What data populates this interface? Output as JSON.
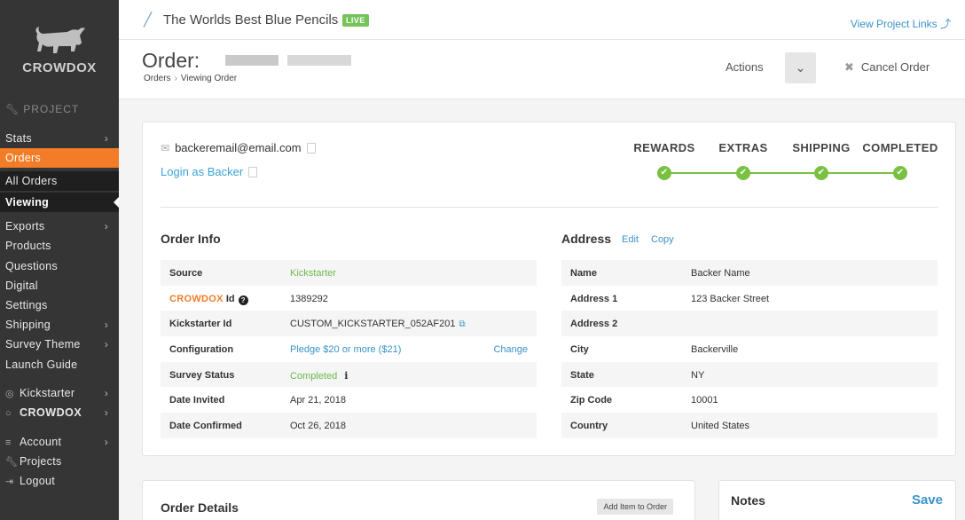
{
  "sidebar": {
    "brand": "CROWDOX",
    "section_label": "PROJECT",
    "items": [
      {
        "label": "Stats",
        "chevron": "›"
      },
      {
        "label": "Orders",
        "chevron": ""
      },
      {
        "label": "All Orders",
        "chevron": ""
      },
      {
        "label": "Viewing",
        "chevron": ""
      },
      {
        "label": "Exports",
        "chevron": "›"
      },
      {
        "label": "Products",
        "chevron": ""
      },
      {
        "label": "Questions",
        "chevron": ""
      },
      {
        "label": "Digital",
        "chevron": ""
      },
      {
        "label": "Settings",
        "chevron": ""
      },
      {
        "label": "Shipping",
        "chevron": "›"
      },
      {
        "label": "Survey Theme",
        "chevron": "›"
      },
      {
        "label": "Launch Guide",
        "chevron": ""
      },
      {
        "label": "Kickstarter",
        "chevron": "›"
      },
      {
        "label": "CROWDOX",
        "chevron": "›"
      },
      {
        "label": "Account",
        "chevron": "›"
      },
      {
        "label": "Projects",
        "chevron": ""
      },
      {
        "label": "Logout",
        "chevron": ""
      }
    ]
  },
  "header": {
    "project_title": "The Worlds Best Blue Pencils",
    "live_badge": "LIVE",
    "view_links": "View Project Links ⤴"
  },
  "order": {
    "title": "Order:",
    "breadcrumb": [
      "Orders",
      "Viewing Order"
    ],
    "actions_label": "Actions",
    "cancel_label": "Cancel Order"
  },
  "backer": {
    "email": "backeremail@email.com",
    "login_as": "Login as Backer"
  },
  "steps": [
    "REWARDS",
    "EXTRAS",
    "SHIPPING",
    "COMPLETED"
  ],
  "order_info": {
    "title": "Order Info",
    "rows": [
      {
        "key": "Source",
        "value": "Kickstarter"
      },
      {
        "key": "Id",
        "brand": "CROWDOX",
        "value": "1389292"
      },
      {
        "key": "Kickstarter Id",
        "value": "CUSTOM_KICKSTARTER_052AF201"
      },
      {
        "key": "Configuration",
        "value": "Pledge $20 or more ($21)",
        "action": "Change"
      },
      {
        "key": "Survey Status",
        "value": "Completed"
      },
      {
        "key": "Date Invited",
        "value": "Apr 21, 2018"
      },
      {
        "key": "Date Confirmed",
        "value": "Oct 26, 2018"
      }
    ]
  },
  "address": {
    "title": "Address",
    "edit": "Edit",
    "copy": "Copy",
    "rows": [
      {
        "key": "Name",
        "value": "Backer Name"
      },
      {
        "key": "Address 1",
        "value": "123 Backer Street"
      },
      {
        "key": "Address 2",
        "value": ""
      },
      {
        "key": "City",
        "value": "Backerville"
      },
      {
        "key": "State",
        "value": "NY"
      },
      {
        "key": "Zip Code",
        "value": "10001"
      },
      {
        "key": "Country",
        "value": "United States"
      }
    ]
  },
  "order_details": {
    "title": "Order Details",
    "add_item": "Add Item to Order"
  },
  "notes": {
    "title": "Notes",
    "save": "Save"
  },
  "colors": {
    "accent": "#f27c28",
    "link": "#3a93c9",
    "success": "#7ac141",
    "sidebar": "#353535"
  }
}
